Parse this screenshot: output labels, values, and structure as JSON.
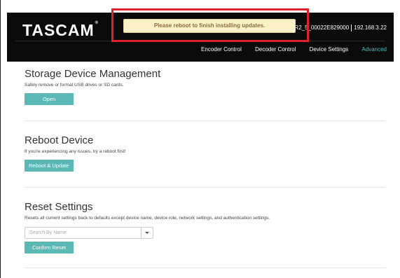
{
  "header": {
    "logo": "TASCAM",
    "logo_mark": "®",
    "device_name": "R2_5_00022E829000",
    "ip": "192.168.3.22"
  },
  "nav": [
    {
      "label": "Encoder Control",
      "active": false
    },
    {
      "label": "Decoder Control",
      "active": false
    },
    {
      "label": "Device Settings",
      "active": false
    },
    {
      "label": "Advanced",
      "active": true
    }
  ],
  "toast": {
    "message": "Please reboot to finish installing updates."
  },
  "sections": {
    "storage": {
      "title": "Storage Device Management",
      "description": "Safely remove or format USB drives or SD cards.",
      "button": "Open"
    },
    "reboot": {
      "title": "Reboot Device",
      "description": "If you're experiencing any issues, try a reboot first!",
      "button": "Reboot & Update"
    },
    "reset": {
      "title": "Reset Settings",
      "description": "Resets all current settings back to defaults except device name, device role, network settings, and authentication settings.",
      "select_placeholder": "Search By Name",
      "button": "Confirm Reset"
    }
  },
  "colors": {
    "accent": "#5bb8b4",
    "nav_active": "#4bbdbd",
    "highlight": "#e0212b"
  }
}
